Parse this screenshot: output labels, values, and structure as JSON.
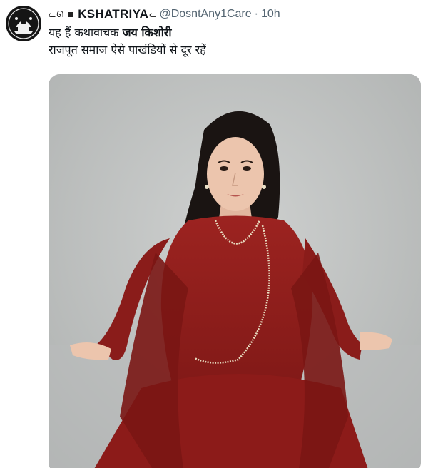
{
  "tweet": {
    "avatar_icon": "emblem-avatar-icon",
    "name_prefix": "ᓚᘏ",
    "display_name": "KSHATRIYA",
    "name_suffix": "ᓚ",
    "handle": "@DosntAny1Care",
    "separator": "·",
    "time": "10h",
    "text_line1_part1": "यह हैं कथावाचक",
    "text_line1_part2": "जय किशोरी",
    "text_line2": "राजपूत समाज ऐसे पाखंडियों से दूर रहें",
    "media_description_icon": "photo-icon"
  },
  "colors": {
    "text_primary": "#0f1419",
    "text_secondary": "#536471",
    "dress_red": "#8f1d1b",
    "backdrop_gray": "#c6c8c7"
  }
}
